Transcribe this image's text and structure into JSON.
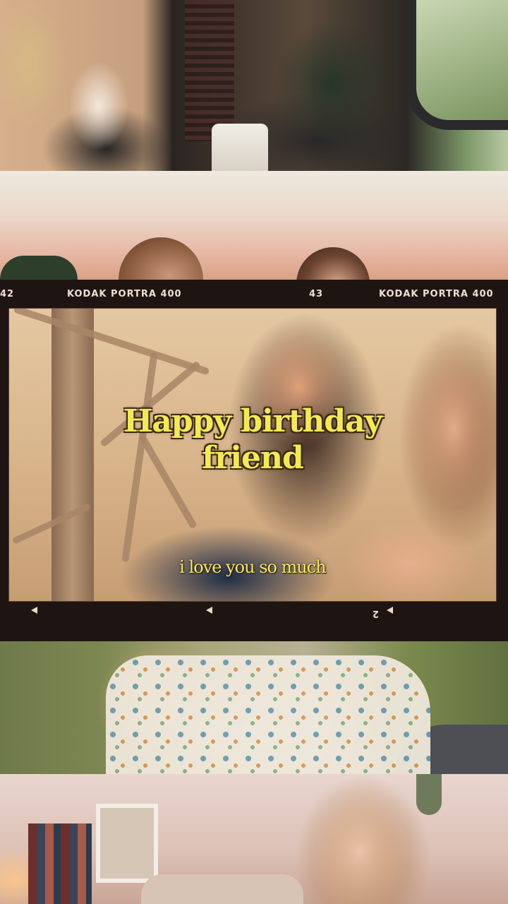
{
  "film": {
    "frame_left_number": "42",
    "frame_left_brand": "KODAK  PORTRA 400",
    "frame_right_number": "43",
    "frame_right_brand": "KODAK  PORTRA 400",
    "bottom_right_number": "2"
  },
  "overlay": {
    "greeting_line1": "Happy birthday",
    "greeting_line2": "friend",
    "love_line": "i love you so much"
  },
  "colors": {
    "title_text": "#f3e85a",
    "film_border": "#1e1512",
    "film_edge_text": "#f0dfd0"
  }
}
